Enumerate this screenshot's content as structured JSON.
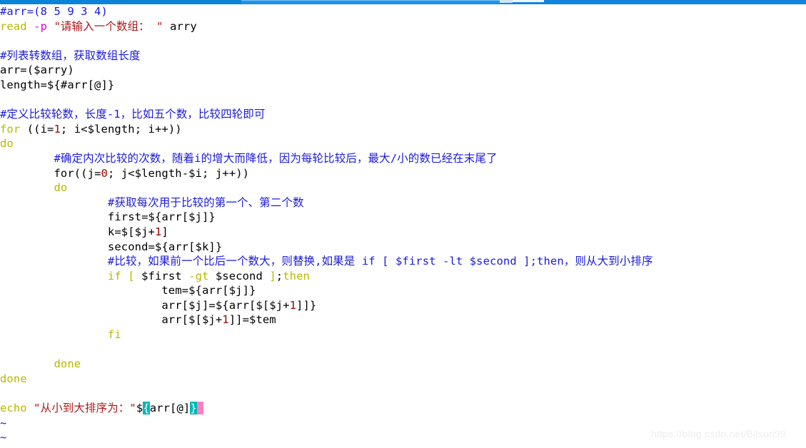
{
  "window": {
    "app": "vim",
    "topbar_color": "#1184e0",
    "background": "#ffffff"
  },
  "watermark": {
    "text": "https://blog.csdn.net/Bilson99"
  },
  "palette": {
    "comment": "#1a1ae0",
    "keyword": "#b8b800",
    "identifier": "#00b8b8",
    "variable": "#e000e0",
    "string": "#b01818",
    "number": "#a00000",
    "plain": "#000000",
    "match_bg": "#00b8b8",
    "cursor_bg": "#ff7fbf"
  },
  "editor": {
    "lines": [
      {
        "n": 1,
        "text": "#arr=(8 5 9 3 4)",
        "spans": [
          {
            "t": "#arr=(8 5 9 3 4)",
            "c": "comment"
          }
        ]
      },
      {
        "n": 2,
        "text": "read -p \"请输入一个数组： \" arry",
        "spans": [
          {
            "t": "read",
            "c": "keyword"
          },
          {
            "t": " ",
            "c": "plain"
          },
          {
            "t": "-p",
            "c": "var"
          },
          {
            "t": " ",
            "c": "plain"
          },
          {
            "t": "\"请输入一个数组： \"",
            "c": "string"
          },
          {
            "t": " arry",
            "c": "plain"
          }
        ]
      },
      {
        "n": 3,
        "text": "",
        "spans": []
      },
      {
        "n": 4,
        "text": "#列表转数组，获取数组长度",
        "spans": [
          {
            "t": "#列表转数组，获取数组长度",
            "c": "comment"
          }
        ]
      },
      {
        "n": 5,
        "text": "arr=($arry)",
        "spans": [
          {
            "t": "arr",
            "c": "identifier"
          },
          {
            "t": "=",
            "c": "plain"
          },
          {
            "t": "($arry)",
            "c": "variable"
          }
        ]
      },
      {
        "n": 6,
        "text": "length=${#arr[@]}",
        "spans": [
          {
            "t": "length",
            "c": "identifier"
          },
          {
            "t": "=",
            "c": "plain"
          },
          {
            "t": "${#arr[@]}",
            "c": "variable"
          }
        ]
      },
      {
        "n": 7,
        "text": "",
        "spans": []
      },
      {
        "n": 8,
        "text": "#定义比较轮数，长度-1，比如五个数，比较四轮即可",
        "spans": [
          {
            "t": "#定义比较轮数，长度-1，比如五个数，比较四轮即可",
            "c": "comment"
          }
        ]
      },
      {
        "n": 9,
        "text": "for ((i=1; i<$length; i++))",
        "spans": [
          {
            "t": "for",
            "c": "keyword"
          },
          {
            "t": " ",
            "c": "plain"
          },
          {
            "t": "((",
            "c": "variable"
          },
          {
            "t": "i",
            "c": "identifier"
          },
          {
            "t": "=",
            "c": "plain"
          },
          {
            "t": "1",
            "c": "number"
          },
          {
            "t": "; i<",
            "c": "plain"
          },
          {
            "t": "$length",
            "c": "variable"
          },
          {
            "t": "; i++",
            "c": "plain"
          },
          {
            "t": "))",
            "c": "variable"
          }
        ]
      },
      {
        "n": 10,
        "text": "do",
        "spans": [
          {
            "t": "do",
            "c": "keyword"
          }
        ]
      },
      {
        "n": 11,
        "text": "        #确定内次比较的次数，随着i的增大而降低，因为每轮比较后，最大/小的数已经在末尾了",
        "spans": [
          {
            "t": "        ",
            "c": "plain"
          },
          {
            "t": "#确定内次比较的次数，随着i的增大而降低，因为每轮比较后，最大/小的数已经在末尾了",
            "c": "comment"
          }
        ]
      },
      {
        "n": 12,
        "text": "        for((j=0; j<$length-$i; j++))",
        "spans": [
          {
            "t": "        for",
            "c": "plain"
          },
          {
            "t": "((",
            "c": "variable"
          },
          {
            "t": "j",
            "c": "identifier"
          },
          {
            "t": "=",
            "c": "plain"
          },
          {
            "t": "0",
            "c": "number"
          },
          {
            "t": "; j<",
            "c": "plain"
          },
          {
            "t": "$length",
            "c": "variable"
          },
          {
            "t": "-",
            "c": "plain"
          },
          {
            "t": "$i",
            "c": "variable"
          },
          {
            "t": "; j++",
            "c": "plain"
          },
          {
            "t": "))",
            "c": "variable"
          }
        ]
      },
      {
        "n": 13,
        "text": "        do",
        "spans": [
          {
            "t": "        ",
            "c": "plain"
          },
          {
            "t": "do",
            "c": "keyword"
          }
        ]
      },
      {
        "n": 14,
        "text": "                #获取每次用于比较的第一个、第二个数",
        "spans": [
          {
            "t": "                ",
            "c": "plain"
          },
          {
            "t": "#获取每次用于比较的第一个、第二个数",
            "c": "comment"
          }
        ]
      },
      {
        "n": 15,
        "text": "                first=${arr[$j]}",
        "spans": [
          {
            "t": "                ",
            "c": "plain"
          },
          {
            "t": "first",
            "c": "identifier"
          },
          {
            "t": "=",
            "c": "plain"
          },
          {
            "t": "${arr[$j]}",
            "c": "variable"
          }
        ]
      },
      {
        "n": 16,
        "text": "                k=$[$j+1]",
        "spans": [
          {
            "t": "                ",
            "c": "plain"
          },
          {
            "t": "k",
            "c": "identifier"
          },
          {
            "t": "=",
            "c": "plain"
          },
          {
            "t": "$[$j+",
            "c": "variable"
          },
          {
            "t": "1",
            "c": "number"
          },
          {
            "t": "]",
            "c": "variable"
          }
        ]
      },
      {
        "n": 17,
        "text": "                second=${arr[$k]}",
        "spans": [
          {
            "t": "                ",
            "c": "plain"
          },
          {
            "t": "second",
            "c": "identifier"
          },
          {
            "t": "=",
            "c": "plain"
          },
          {
            "t": "${arr[$k]}",
            "c": "variable"
          }
        ]
      },
      {
        "n": 18,
        "text": "                #比较，如果前一个比后一个数大，则替换,如果是 if [ $first -lt $second ];then，则从大到小排序",
        "spans": [
          {
            "t": "                ",
            "c": "plain"
          },
          {
            "t": "#比较，如果前一个比后一个数大，则替换,如果是 if [ $first -lt $second ];then，则从大到小排序",
            "c": "comment"
          }
        ]
      },
      {
        "n": 19,
        "text": "                if [ $first -gt $second ];then",
        "spans": [
          {
            "t": "                ",
            "c": "plain"
          },
          {
            "t": "if",
            "c": "keyword"
          },
          {
            "t": " ",
            "c": "plain"
          },
          {
            "t": "[",
            "c": "keyword"
          },
          {
            "t": " ",
            "c": "plain"
          },
          {
            "t": "$first",
            "c": "variable"
          },
          {
            "t": " ",
            "c": "plain"
          },
          {
            "t": "-gt",
            "c": "keyword"
          },
          {
            "t": " ",
            "c": "plain"
          },
          {
            "t": "$second",
            "c": "variable"
          },
          {
            "t": " ",
            "c": "plain"
          },
          {
            "t": "]",
            "c": "keyword"
          },
          {
            "t": ";",
            "c": "variable"
          },
          {
            "t": "then",
            "c": "keyword"
          }
        ]
      },
      {
        "n": 20,
        "text": "                        tem=${arr[$j]}",
        "spans": [
          {
            "t": "                        ",
            "c": "plain"
          },
          {
            "t": "tem",
            "c": "identifier"
          },
          {
            "t": "=",
            "c": "plain"
          },
          {
            "t": "${arr[$j]}",
            "c": "variable"
          }
        ]
      },
      {
        "n": 21,
        "text": "                        arr[$j]=${arr[$[$j+1]]}",
        "spans": [
          {
            "t": "                        arr",
            "c": "plain"
          },
          {
            "t": "[$j]",
            "c": "variable"
          },
          {
            "t": "=",
            "c": "plain"
          },
          {
            "t": "${arr[$[$j+",
            "c": "variable"
          },
          {
            "t": "1",
            "c": "number"
          },
          {
            "t": "]]}",
            "c": "variable"
          }
        ]
      },
      {
        "n": 22,
        "text": "                        arr[$[$j+1]]=$tem",
        "spans": [
          {
            "t": "                        arr",
            "c": "plain"
          },
          {
            "t": "[$[$j+",
            "c": "variable"
          },
          {
            "t": "1",
            "c": "number"
          },
          {
            "t": "]]",
            "c": "variable"
          },
          {
            "t": "=",
            "c": "plain"
          },
          {
            "t": "$tem",
            "c": "variable"
          }
        ]
      },
      {
        "n": 23,
        "text": "                fi",
        "spans": [
          {
            "t": "                ",
            "c": "plain"
          },
          {
            "t": "fi",
            "c": "keyword"
          }
        ]
      },
      {
        "n": 24,
        "text": "",
        "spans": []
      },
      {
        "n": 25,
        "text": "        done",
        "spans": [
          {
            "t": "        ",
            "c": "plain"
          },
          {
            "t": "done",
            "c": "keyword"
          }
        ]
      },
      {
        "n": 26,
        "text": "done",
        "spans": [
          {
            "t": "done",
            "c": "keyword"
          }
        ]
      },
      {
        "n": 27,
        "text": "",
        "spans": []
      },
      {
        "n": 28,
        "text": "echo \"从小到大排序为：\"${arr[@]}",
        "spans": [
          {
            "t": "echo",
            "c": "keyword"
          },
          {
            "t": " ",
            "c": "plain"
          },
          {
            "t": "\"从小到大排序为：\"",
            "c": "string"
          },
          {
            "t": "$",
            "c": "variable"
          },
          {
            "t": "{",
            "c": "match"
          },
          {
            "t": "arr[@]",
            "c": "variable"
          },
          {
            "t": "}",
            "c": "match"
          },
          {
            "t": " ",
            "c": "cursor"
          }
        ]
      },
      {
        "n": 29,
        "text": "~",
        "spans": [
          {
            "t": "~",
            "c": "tilde"
          }
        ]
      },
      {
        "n": 30,
        "text": "~",
        "spans": [
          {
            "t": "~",
            "c": "tilde"
          }
        ]
      }
    ]
  }
}
